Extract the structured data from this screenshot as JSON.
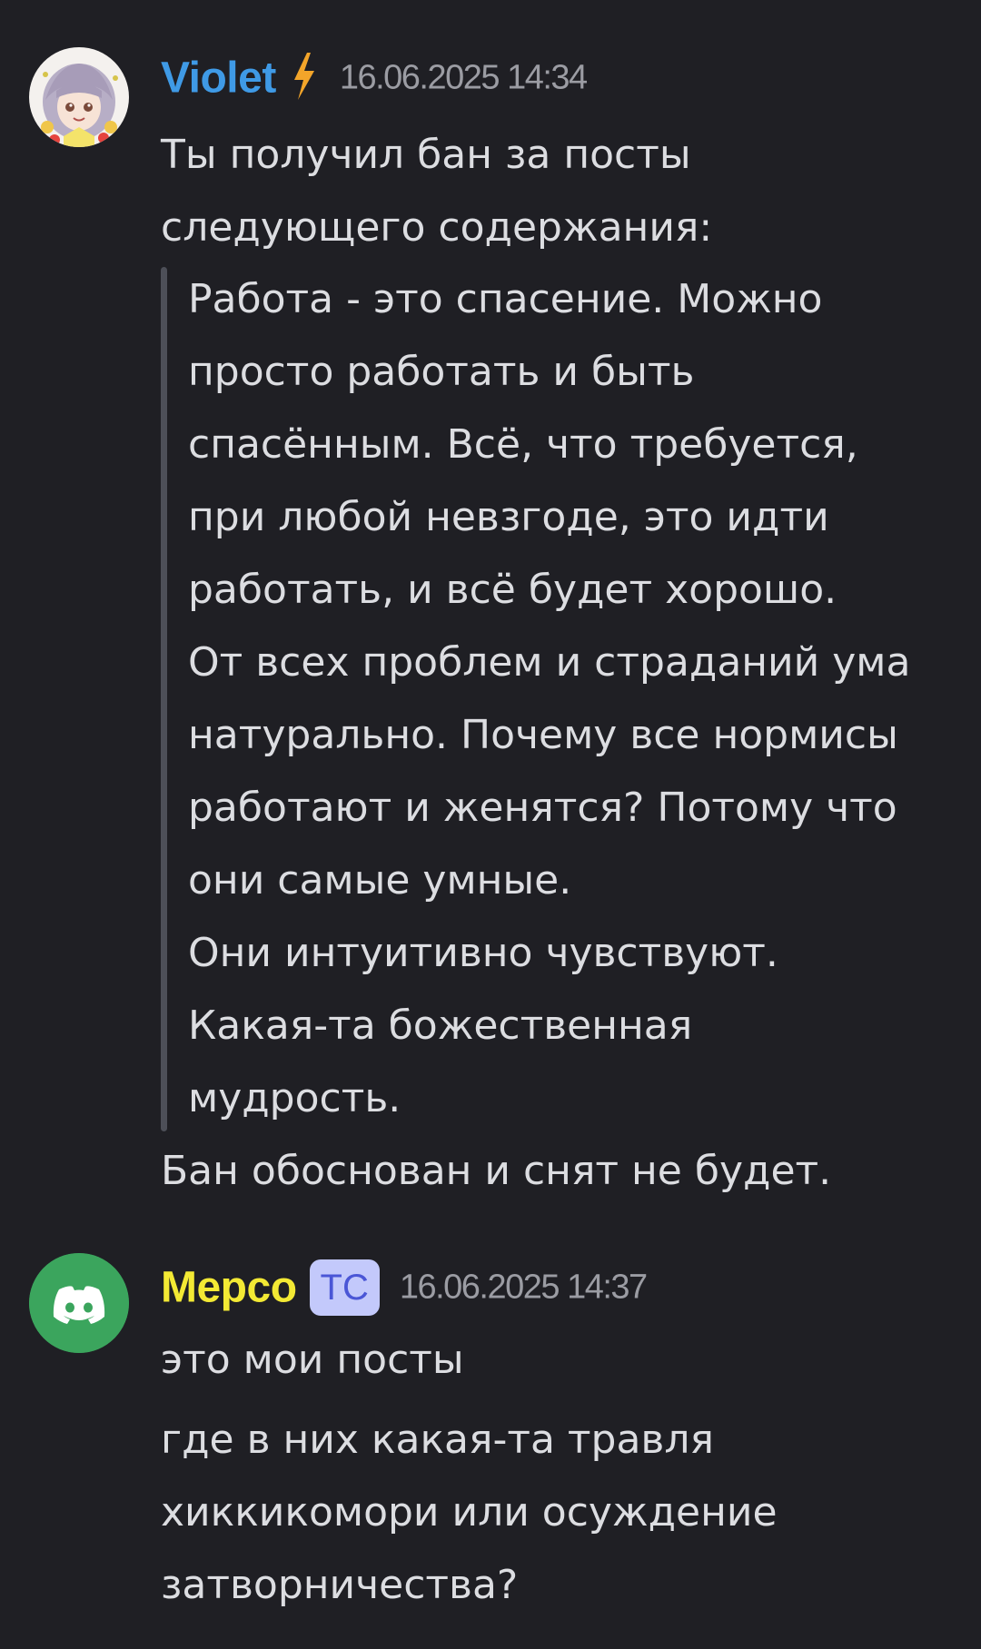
{
  "messages": [
    {
      "author": "Violet",
      "author_color": "#3f9ae6",
      "author_icon": "lightning-bolt-icon",
      "timestamp": "16.06.2025 14:34",
      "intro_lines": [
        "Ты получил бан за посты",
        "следующего содержания:"
      ],
      "quote_lines": [
        "Работа - это спасение. Можно",
        "просто работать и быть",
        "спасённым. Всё, что требуется,",
        "при любой невзгоде, это идти",
        "работать, и всё будет хорошо.",
        "От всех проблем и страданий ума",
        "натурально. Почему все нормисы",
        "работают и женятся? Потому что",
        "они самые умные.",
        "Они интуитивно чувствуют.",
        "Какая-та божественная",
        "мудрость."
      ],
      "outro_lines": [
        "Бан обоснован и снят не будет."
      ]
    },
    {
      "author": "Mepco",
      "author_color": "#f3e934",
      "badge": "TC",
      "timestamp": "16.06.2025 14:37",
      "avatar_color": "#3ba55d",
      "avatar_icon": "discord-logo-icon",
      "lines": [
        "это мои посты",
        "где в них какая-та травля",
        "хиккикомори или осуждение",
        "затворничества?"
      ]
    }
  ]
}
